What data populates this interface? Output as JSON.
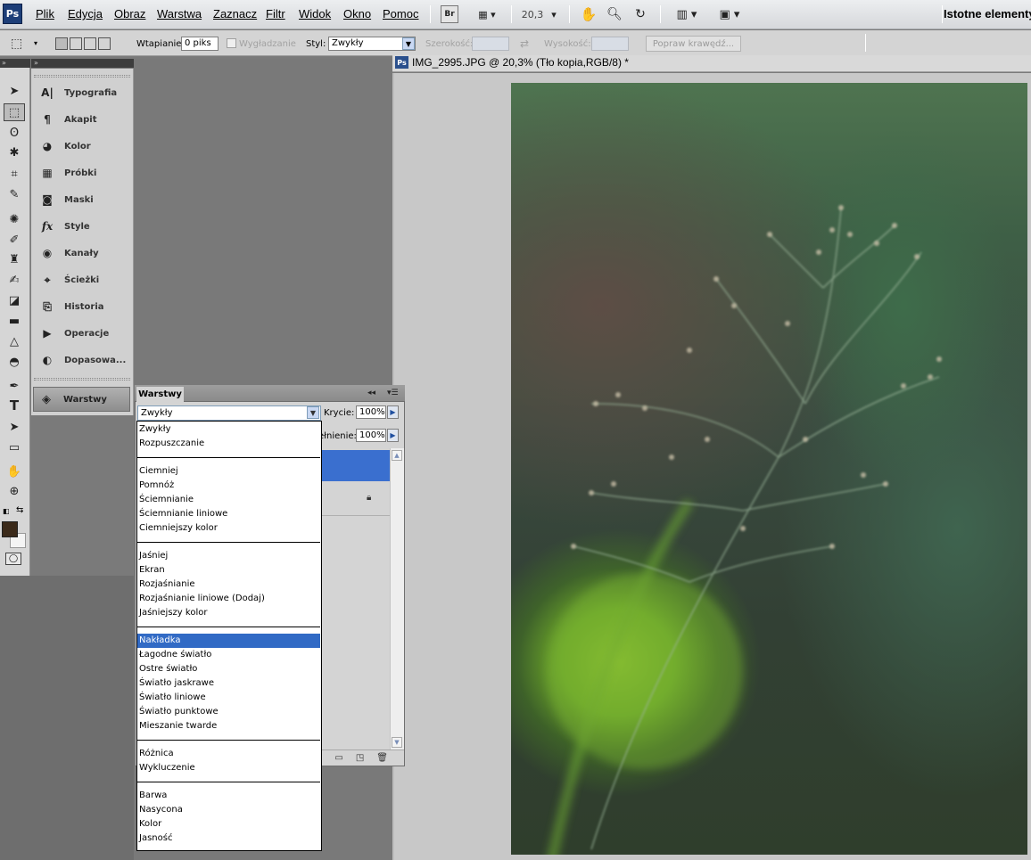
{
  "app": {
    "logo": "Ps",
    "workspace": "Istotne elementy"
  },
  "menu": [
    "Plik",
    "Edycja",
    "Obraz",
    "Warstwa",
    "Zaznacz",
    "Filtr",
    "Widok",
    "Okno",
    "Pomoc"
  ],
  "appbar": {
    "bridge": "Br",
    "zoom": "20,3"
  },
  "options": {
    "feather_label": "Wtapianie:",
    "feather_value": "0 piks",
    "antialias_label": "Wygładzanie",
    "style_label": "Styl:",
    "style_value": "Zwykły",
    "width_label": "Szerokość:",
    "height_label": "Wysokość:",
    "refine_button": "Popraw krawędź..."
  },
  "dock": {
    "items": [
      {
        "label": "Typografia",
        "icon": "A|"
      },
      {
        "label": "Akapit",
        "icon": "¶"
      },
      {
        "label": "Kolor",
        "icon": "◕"
      },
      {
        "label": "Próbki",
        "icon": "▦"
      },
      {
        "label": "Maski",
        "icon": "◙"
      },
      {
        "label": "Style",
        "icon": "fx"
      },
      {
        "label": "Kanały",
        "icon": "◉"
      },
      {
        "label": "Ścieżki",
        "icon": "⌖"
      },
      {
        "label": "Historia",
        "icon": "⎘"
      },
      {
        "label": "Operacje",
        "icon": "▶"
      },
      {
        "label": "Dopasowa...",
        "icon": "◐"
      }
    ],
    "layers_button": "Warstwy"
  },
  "document": {
    "title": "IMG_2995.JPG @ 20,3% (Tło kopia,RGB/8) *"
  },
  "layers": {
    "tab": "Warstwy",
    "blend_mode": "Zwykły",
    "opacity_label": "Krycie:",
    "opacity": "100%",
    "fill_label": "ełnienie:",
    "fill": "100%"
  },
  "blend_dropdown": {
    "groups": [
      [
        "Zwykły",
        "Rozpuszczanie"
      ],
      [
        "Ciemniej",
        "Pomnóż",
        "Ściemnianie",
        "Ściemnianie liniowe",
        "Ciemniejszy kolor"
      ],
      [
        "Jaśniej",
        "Ekran",
        "Rozjaśnianie",
        "Rozjaśnianie liniowe (Dodaj)",
        "Jaśniejszy kolor"
      ],
      [
        "Nakładka",
        "Łagodne światło",
        "Ostre światło",
        "Światło jaskrawe",
        "Światło liniowe",
        "Światło punktowe",
        "Mieszanie twarde"
      ],
      [
        "Różnica",
        "Wykluczenie"
      ],
      [
        "Barwa",
        "Nasycona",
        "Kolor",
        "Jasność"
      ]
    ],
    "selected": "Nakładka"
  },
  "colors": {
    "accent": "#316ac5",
    "foreground_swatch": "#3b2a1a",
    "background_swatch": "#ffffff"
  }
}
